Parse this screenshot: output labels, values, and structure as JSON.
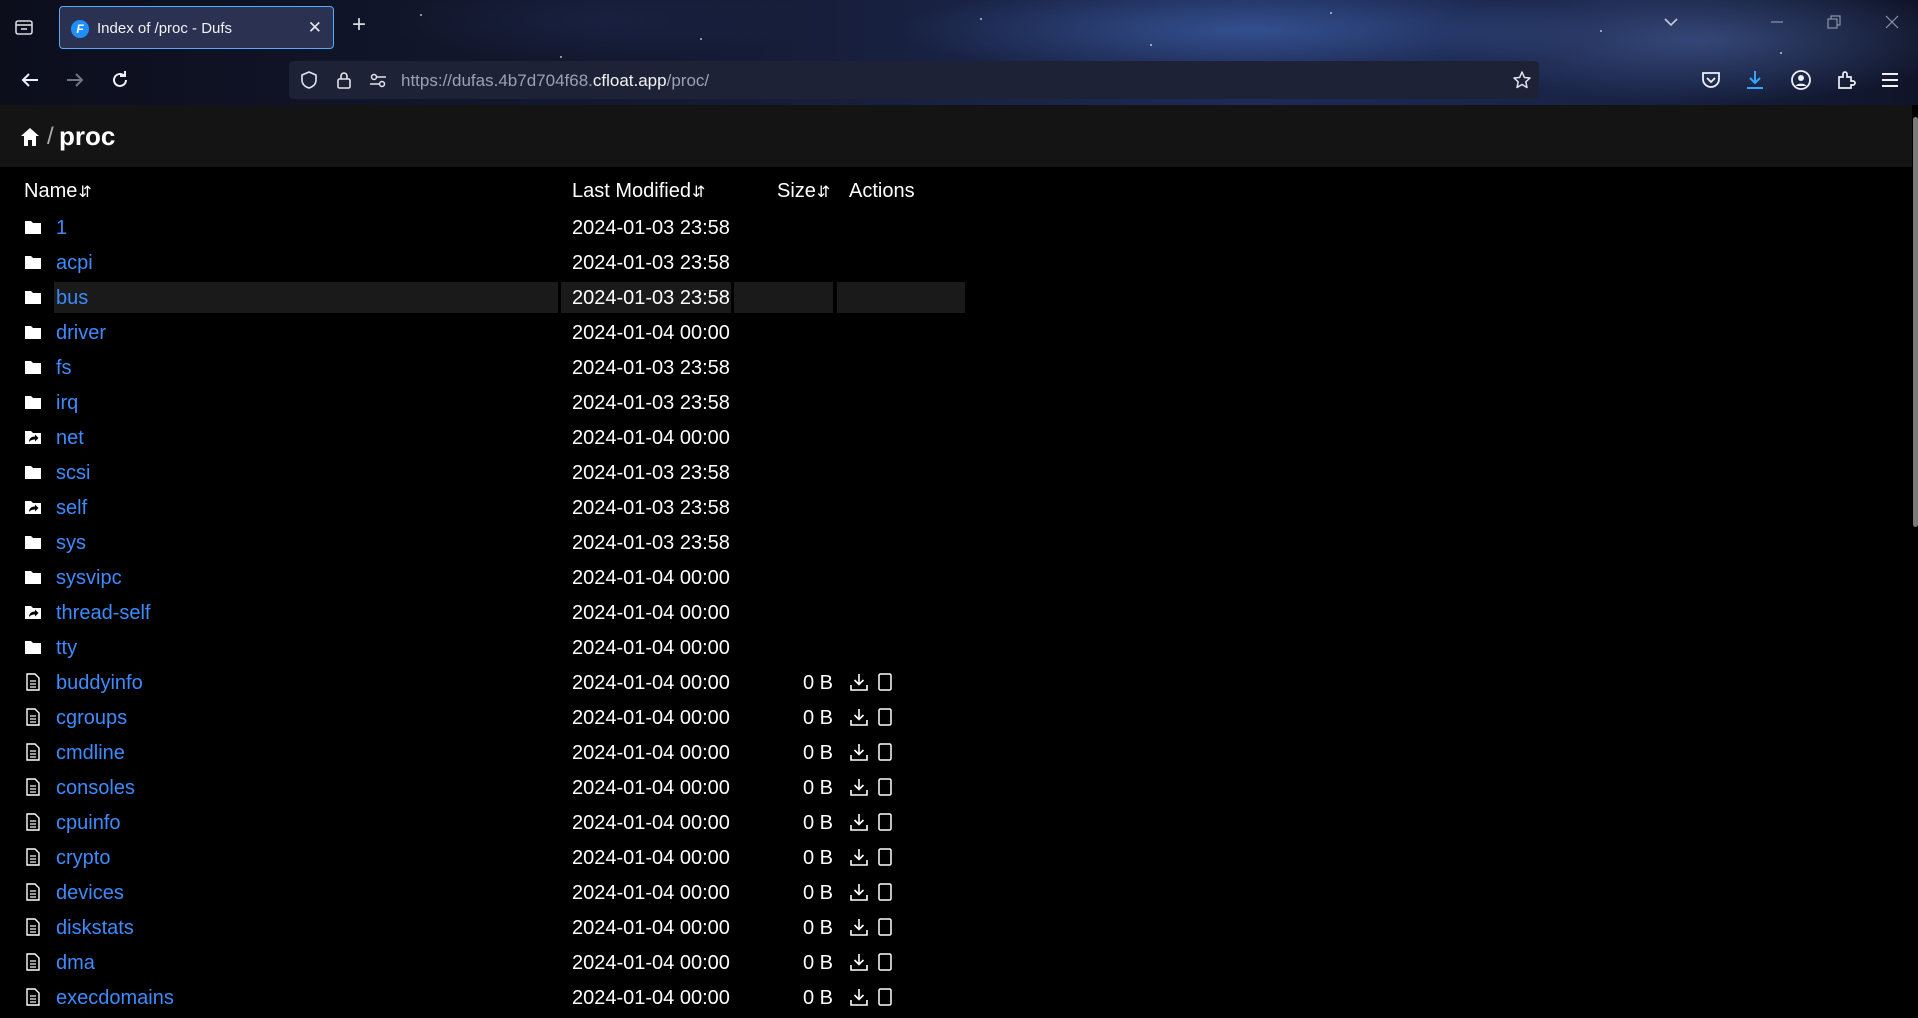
{
  "browser": {
    "tab_title": "Index of /proc - Dufs",
    "tab_favicon_letter": "F",
    "url_prefix": "https://dufas.4b7d704f68.",
    "url_domain": "cfloat.app",
    "url_path": "/proc/",
    "icons": [
      "tab-list-icon",
      "close-icon",
      "plus-icon",
      "chevron-down-icon",
      "minimize-icon",
      "restore-icon",
      "window-close-icon",
      "back-icon",
      "forward-icon",
      "reload-icon",
      "shield-icon",
      "lock-icon",
      "permissions-icon",
      "star-icon",
      "pocket-icon",
      "download-icon",
      "account-icon",
      "extensions-icon",
      "menu-icon"
    ]
  },
  "breadcrumb": {
    "separator": "/",
    "current": "proc"
  },
  "columns": {
    "name": "Name",
    "modified": "Last Modified",
    "size": "Size",
    "actions": "Actions",
    "sort_glyph": "⇵"
  },
  "rows": [
    {
      "type": "dir",
      "name": "1",
      "modified": "2024-01-03 23:58",
      "size": ""
    },
    {
      "type": "dir",
      "name": "acpi",
      "modified": "2024-01-03 23:58",
      "size": ""
    },
    {
      "type": "dir",
      "name": "bus",
      "modified": "2024-01-03 23:58",
      "size": "",
      "hover": true
    },
    {
      "type": "dir",
      "name": "driver",
      "modified": "2024-01-04 00:00",
      "size": ""
    },
    {
      "type": "dir",
      "name": "fs",
      "modified": "2024-01-03 23:58",
      "size": ""
    },
    {
      "type": "dir",
      "name": "irq",
      "modified": "2024-01-03 23:58",
      "size": ""
    },
    {
      "type": "symlink-dir",
      "name": "net",
      "modified": "2024-01-04 00:00",
      "size": ""
    },
    {
      "type": "dir",
      "name": "scsi",
      "modified": "2024-01-03 23:58",
      "size": ""
    },
    {
      "type": "symlink-dir",
      "name": "self",
      "modified": "2024-01-03 23:58",
      "size": ""
    },
    {
      "type": "dir",
      "name": "sys",
      "modified": "2024-01-03 23:58",
      "size": ""
    },
    {
      "type": "dir",
      "name": "sysvipc",
      "modified": "2024-01-04 00:00",
      "size": ""
    },
    {
      "type": "symlink-dir",
      "name": "thread-self",
      "modified": "2024-01-04 00:00",
      "size": ""
    },
    {
      "type": "dir",
      "name": "tty",
      "modified": "2024-01-04 00:00",
      "size": ""
    },
    {
      "type": "file",
      "name": "buddyinfo",
      "modified": "2024-01-04 00:00",
      "size": "0 B"
    },
    {
      "type": "file",
      "name": "cgroups",
      "modified": "2024-01-04 00:00",
      "size": "0 B"
    },
    {
      "type": "file",
      "name": "cmdline",
      "modified": "2024-01-04 00:00",
      "size": "0 B"
    },
    {
      "type": "file",
      "name": "consoles",
      "modified": "2024-01-04 00:00",
      "size": "0 B"
    },
    {
      "type": "file",
      "name": "cpuinfo",
      "modified": "2024-01-04 00:00",
      "size": "0 B"
    },
    {
      "type": "file",
      "name": "crypto",
      "modified": "2024-01-04 00:00",
      "size": "0 B"
    },
    {
      "type": "file",
      "name": "devices",
      "modified": "2024-01-04 00:00",
      "size": "0 B"
    },
    {
      "type": "file",
      "name": "diskstats",
      "modified": "2024-01-04 00:00",
      "size": "0 B"
    },
    {
      "type": "file",
      "name": "dma",
      "modified": "2024-01-04 00:00",
      "size": "0 B"
    },
    {
      "type": "file",
      "name": "execdomains",
      "modified": "2024-01-04 00:00",
      "size": "0 B"
    }
  ],
  "colors": {
    "link": "#3d8bfd",
    "page_bg": "#000000",
    "header_bg": "#141414",
    "row_hover": "#1a1a1a",
    "tab_border": "#5aa7ff"
  }
}
